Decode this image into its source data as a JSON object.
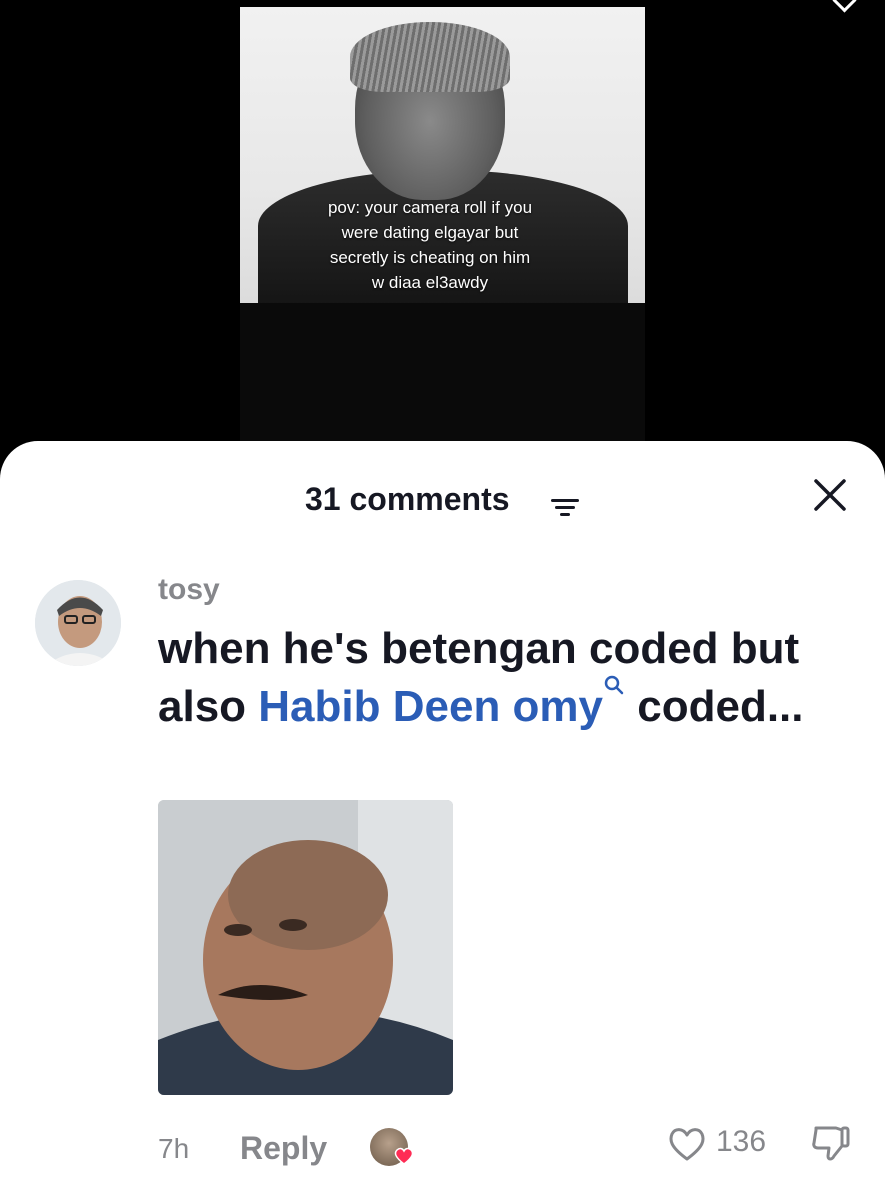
{
  "video": {
    "caption_lines": [
      "pov: your camera roll if you",
      "were dating elgayar but",
      "secretly is cheating on him",
      "w diaa el3awdy"
    ]
  },
  "comments_sheet": {
    "title": "31 comments",
    "sort_icon": "filter-lines-icon",
    "close_icon": "close-icon"
  },
  "comment": {
    "username": "tosy",
    "text_before_link": "when he's betengan coded but also ",
    "link_text": "Habib Deen omy",
    "text_after_link": " coded...",
    "timestamp": "7h",
    "reply_label": "Reply",
    "like_count": "136"
  },
  "colors": {
    "link": "#2b5db6",
    "secondary_text": "#86878b",
    "primary_text": "#161823",
    "heart_badge": "#fe2c55"
  }
}
